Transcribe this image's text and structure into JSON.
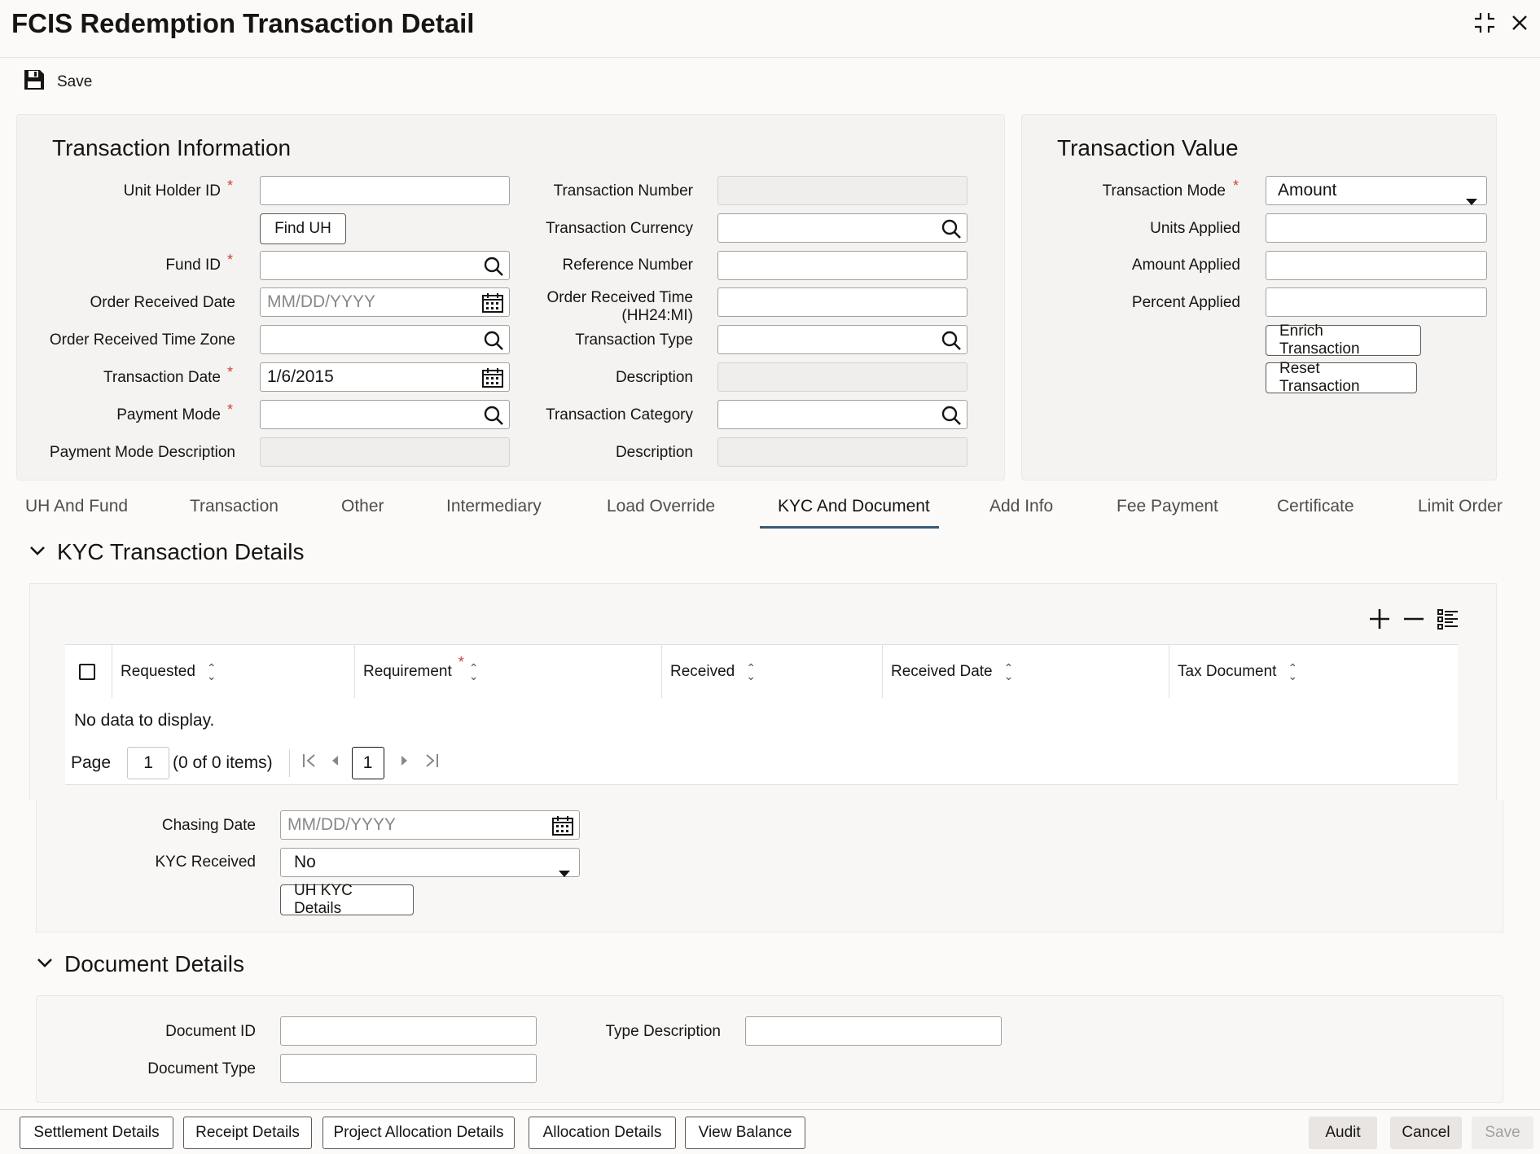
{
  "window": {
    "title": "FCIS Redemption Transaction Detail"
  },
  "toolbar": {
    "save_label": "Save"
  },
  "transaction_info": {
    "title": "Transaction Information",
    "unit_holder_id_label": "Unit Holder ID",
    "unit_holder_id_value": "",
    "find_uh_label": "Find UH",
    "fund_id_label": "Fund ID",
    "fund_id_value": "",
    "order_received_date_label": "Order Received Date",
    "order_received_date_placeholder": "MM/DD/YYYY",
    "order_received_time_zone_label": "Order Received Time Zone",
    "order_received_time_zone_value": "",
    "transaction_date_label": "Transaction Date",
    "transaction_date_value": "1/6/2015",
    "payment_mode_label": "Payment Mode",
    "payment_mode_value": "",
    "payment_mode_description_label": "Payment Mode Description",
    "payment_mode_description_value": "",
    "transaction_number_label": "Transaction Number",
    "transaction_number_value": "",
    "transaction_currency_label": "Transaction Currency",
    "transaction_currency_value": "",
    "reference_number_label": "Reference Number",
    "reference_number_value": "",
    "order_received_time_label_1": "Order Received Time",
    "order_received_time_label_2": "(HH24:MI)",
    "order_received_time_value": "",
    "transaction_type_label": "Transaction Type",
    "transaction_type_value": "",
    "description_label_1": "Description",
    "description_value_1": "",
    "transaction_category_label": "Transaction Category",
    "transaction_category_value": "",
    "description_label_2": "Description",
    "description_value_2": ""
  },
  "transaction_value": {
    "title": "Transaction Value",
    "transaction_mode_label": "Transaction Mode",
    "transaction_mode_value": "Amount",
    "units_applied_label": "Units Applied",
    "units_applied_value": "",
    "amount_applied_label": "Amount Applied",
    "amount_applied_value": "",
    "percent_applied_label": "Percent Applied",
    "percent_applied_value": "",
    "enrich_label": "Enrich Transaction",
    "reset_label": "Reset Transaction"
  },
  "tabs": [
    {
      "label": "UH And Fund"
    },
    {
      "label": "Transaction"
    },
    {
      "label": "Other"
    },
    {
      "label": "Intermediary"
    },
    {
      "label": "Load Override"
    },
    {
      "label": "KYC And Document"
    },
    {
      "label": "Add Info"
    },
    {
      "label": "Fee Payment"
    },
    {
      "label": "Certificate"
    },
    {
      "label": "Limit Order"
    }
  ],
  "active_tab": "KYC And Document",
  "kyc": {
    "title": "KYC Transaction Details",
    "columns": [
      "Requested",
      "Requirement",
      "Received",
      "Received Date",
      "Tax Document"
    ],
    "empty_text": "No data to display.",
    "page_label": "Page",
    "page_value": "1",
    "items_text": "(0 of 0 items)",
    "current_page": "1",
    "chasing_date_label": "Chasing Date",
    "chasing_date_placeholder": "MM/DD/YYYY",
    "kyc_received_label": "KYC Received",
    "kyc_received_value": "No",
    "uh_kyc_details_label": "UH KYC Details"
  },
  "document": {
    "title": "Document Details",
    "document_id_label": "Document ID",
    "document_id_value": "",
    "type_description_label": "Type Description",
    "type_description_value": "",
    "document_type_label": "Document Type",
    "document_type_value": ""
  },
  "bottom_bar": {
    "settlement_details": "Settlement Details",
    "receipt_details": "Receipt Details",
    "project_allocation_details": "Project Allocation Details",
    "allocation_details": "Allocation Details",
    "view_balance": "View Balance",
    "audit": "Audit",
    "cancel": "Cancel",
    "save": "Save"
  }
}
